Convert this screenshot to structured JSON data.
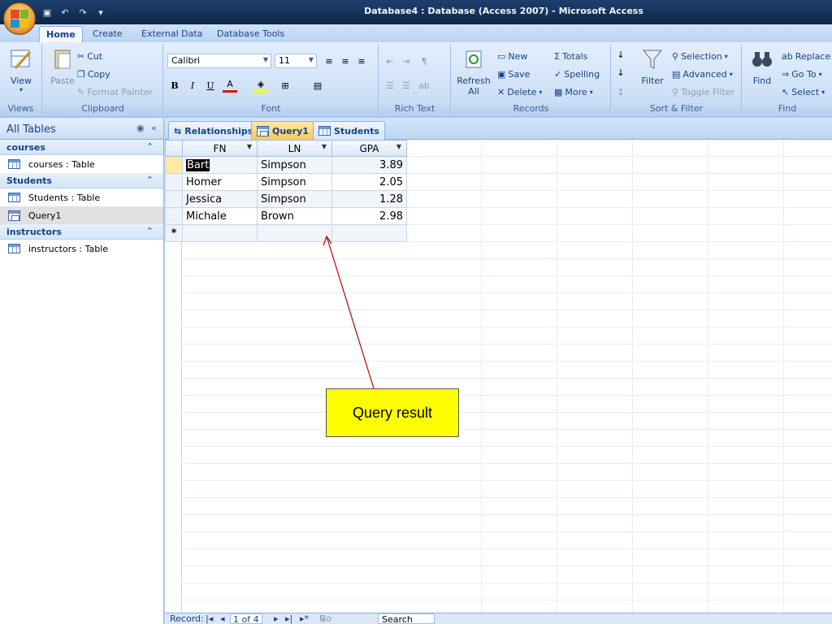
{
  "window": {
    "title": "Database4 : Database (Access 2007) - Microsoft Access"
  },
  "ribbon_tabs": [
    "Home",
    "Create",
    "External Data",
    "Database Tools"
  ],
  "ribbon": {
    "views": {
      "view_label": "View",
      "group_label": "Views"
    },
    "clipboard": {
      "paste_label": "Paste",
      "cut_label": "Cut",
      "copy_label": "Copy",
      "format_painter_label": "Format Painter",
      "group_label": "Clipboard"
    },
    "font": {
      "font_name": "Calibri",
      "font_size": "11",
      "bold": "B",
      "italic": "I",
      "underline": "U",
      "font_color": "A",
      "group_label": "Font"
    },
    "rich_text": {
      "group_label": "Rich Text"
    },
    "records": {
      "refresh_label": "Refresh All",
      "new_label": "New",
      "save_label": "Save",
      "delete_label": "Delete",
      "totals_label": "Totals",
      "spelling_label": "Spelling",
      "more_label": "More",
      "group_label": "Records"
    },
    "sort_filter": {
      "filter_label": "Filter",
      "selection_label": "Selection",
      "advanced_label": "Advanced",
      "toggle_filter_label": "Toggle Filter",
      "group_label": "Sort & Filter"
    },
    "find": {
      "find_label": "Find",
      "replace_label": "Replace",
      "goto_label": "Go To",
      "select_label": "Select",
      "group_label": "Find"
    }
  },
  "nav": {
    "header": "All Tables",
    "groups": [
      {
        "name": "courses",
        "items": [
          "courses : Table"
        ]
      },
      {
        "name": "Students",
        "items": [
          "Students : Table",
          "Query1"
        ]
      },
      {
        "name": "instructors",
        "items": [
          "instructors : Table"
        ]
      }
    ]
  },
  "doc_tabs": [
    "Relationships",
    "Query1",
    "Students"
  ],
  "datasheet": {
    "columns": [
      "FN",
      "LN",
      "GPA"
    ],
    "rows": [
      [
        "Bart",
        "Simpson",
        "3.89"
      ],
      [
        "Homer",
        "Simpson",
        "2.05"
      ],
      [
        "Jessica",
        "Simpson",
        "1.28"
      ],
      [
        "Michale",
        "Brown",
        "2.98"
      ]
    ],
    "new_row_marker": "*"
  },
  "record_nav": {
    "label": "Record:",
    "position": "1 of 4",
    "no_filter": "No Filter",
    "search": "Search"
  },
  "annotation": {
    "text": "Query result"
  }
}
